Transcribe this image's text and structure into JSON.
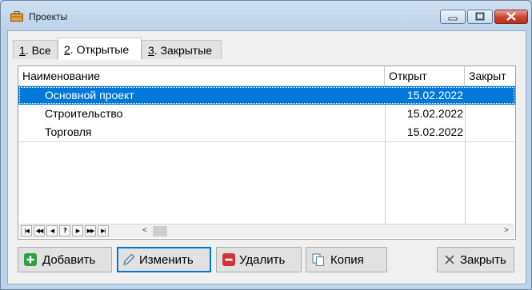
{
  "window": {
    "title": "Проекты"
  },
  "tabs": [
    {
      "label": "1. Все",
      "underline": "1",
      "rest": ". Все"
    },
    {
      "label": "2. Открытые",
      "underline": "2",
      "rest": ". Открытые"
    },
    {
      "label": "3. Закрытые",
      "underline": "3",
      "rest": ". Закрытые"
    }
  ],
  "active_tab": 1,
  "grid": {
    "columns": [
      "Наименование",
      "Открыт",
      "Закрыт"
    ],
    "rows": [
      {
        "name": "Основной проект",
        "opened": "15.02.2022",
        "closed": "",
        "selected": true
      },
      {
        "name": "Строительство",
        "opened": "15.02.2022",
        "closed": "",
        "selected": false
      },
      {
        "name": "Торговля",
        "opened": "15.02.2022",
        "closed": "",
        "selected": false
      }
    ],
    "navigator": [
      "first",
      "prev-page",
      "prev",
      "?",
      "next",
      "next-page",
      "last"
    ]
  },
  "buttons": {
    "add": "Добавить",
    "edit": "Изменить",
    "delete": "Удалить",
    "copy": "Копия",
    "close": "Закрыть"
  },
  "colors": {
    "selection": "#0078d7",
    "add_icon": "#2ea043",
    "delete_icon": "#d13438",
    "focus": "#0078d7"
  }
}
